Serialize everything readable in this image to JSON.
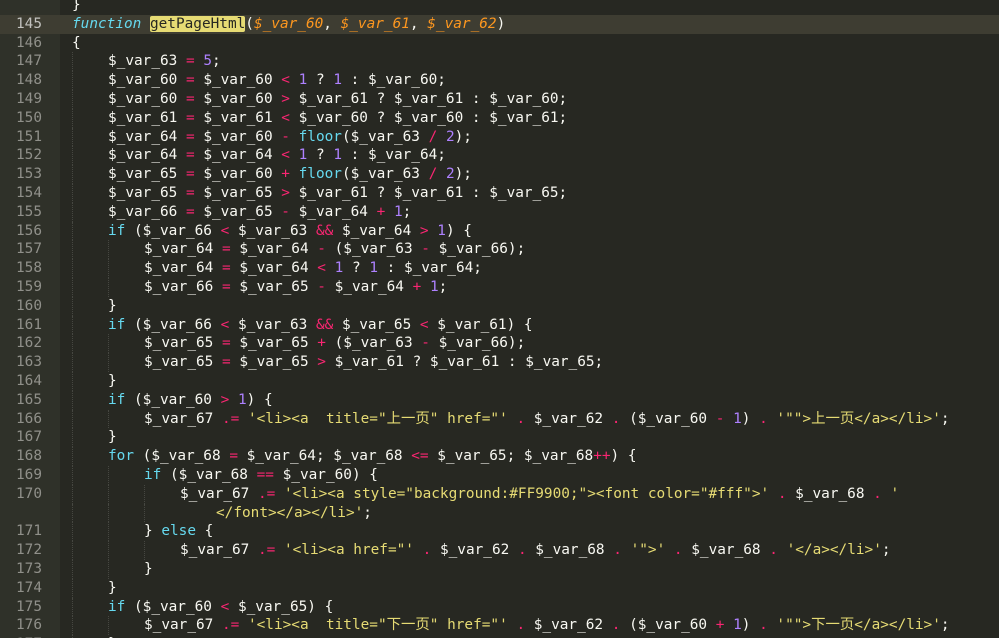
{
  "editor": {
    "theme_colors": {
      "background": "#272822",
      "keyword": "#66d9ef",
      "operator": "#f92672",
      "number": "#ae81ff",
      "string": "#e6db74",
      "param": "#fd971f",
      "text": "#f8f8f2"
    },
    "highlighted_line": "145",
    "lines": [
      {
        "n": "",
        "indent": 0,
        "tokens": [
          [
            "tx",
            "}"
          ]
        ]
      },
      {
        "n": "145",
        "indent": 0,
        "tokens": [
          [
            "kw",
            "function"
          ],
          [
            "tx",
            " "
          ],
          [
            "fn-hl",
            "getPageHtml"
          ],
          [
            "tx",
            "("
          ],
          [
            "pa",
            "$_var_60"
          ],
          [
            "tx",
            ", "
          ],
          [
            "pa",
            "$_var_61"
          ],
          [
            "tx",
            ", "
          ],
          [
            "pa",
            "$_var_62"
          ],
          [
            "tx",
            ")"
          ]
        ]
      },
      {
        "n": "146",
        "indent": 0,
        "tokens": [
          [
            "tx",
            "{"
          ]
        ]
      },
      {
        "n": "147",
        "indent": 1,
        "tokens": [
          [
            "tx",
            "$_var_63 "
          ],
          [
            "op",
            "="
          ],
          [
            "tx",
            " "
          ],
          [
            "num",
            "5"
          ],
          [
            "tx",
            ";"
          ]
        ]
      },
      {
        "n": "148",
        "indent": 1,
        "tokens": [
          [
            "tx",
            "$_var_60 "
          ],
          [
            "op",
            "="
          ],
          [
            "tx",
            " $_var_60 "
          ],
          [
            "op",
            "<"
          ],
          [
            "tx",
            " "
          ],
          [
            "num",
            "1"
          ],
          [
            "tx",
            " ? "
          ],
          [
            "num",
            "1"
          ],
          [
            "tx",
            " : $_var_60;"
          ]
        ]
      },
      {
        "n": "149",
        "indent": 1,
        "tokens": [
          [
            "tx",
            "$_var_60 "
          ],
          [
            "op",
            "="
          ],
          [
            "tx",
            " $_var_60 "
          ],
          [
            "op",
            ">"
          ],
          [
            "tx",
            " $_var_61 ? $_var_61 : $_var_60;"
          ]
        ]
      },
      {
        "n": "150",
        "indent": 1,
        "tokens": [
          [
            "tx",
            "$_var_61 "
          ],
          [
            "op",
            "="
          ],
          [
            "tx",
            " $_var_61 "
          ],
          [
            "op",
            "<"
          ],
          [
            "tx",
            " $_var_60 ? $_var_60 : $_var_61;"
          ]
        ]
      },
      {
        "n": "151",
        "indent": 1,
        "tokens": [
          [
            "tx",
            "$_var_64 "
          ],
          [
            "op",
            "="
          ],
          [
            "tx",
            " $_var_60 "
          ],
          [
            "op",
            "-"
          ],
          [
            "tx",
            " "
          ],
          [
            "bi",
            "floor"
          ],
          [
            "tx",
            "($_var_63 "
          ],
          [
            "op",
            "/"
          ],
          [
            "tx",
            " "
          ],
          [
            "num",
            "2"
          ],
          [
            "tx",
            ");"
          ]
        ]
      },
      {
        "n": "152",
        "indent": 1,
        "tokens": [
          [
            "tx",
            "$_var_64 "
          ],
          [
            "op",
            "="
          ],
          [
            "tx",
            " $_var_64 "
          ],
          [
            "op",
            "<"
          ],
          [
            "tx",
            " "
          ],
          [
            "num",
            "1"
          ],
          [
            "tx",
            " ? "
          ],
          [
            "num",
            "1"
          ],
          [
            "tx",
            " : $_var_64;"
          ]
        ]
      },
      {
        "n": "153",
        "indent": 1,
        "tokens": [
          [
            "tx",
            "$_var_65 "
          ],
          [
            "op",
            "="
          ],
          [
            "tx",
            " $_var_60 "
          ],
          [
            "op",
            "+"
          ],
          [
            "tx",
            " "
          ],
          [
            "bi",
            "floor"
          ],
          [
            "tx",
            "($_var_63 "
          ],
          [
            "op",
            "/"
          ],
          [
            "tx",
            " "
          ],
          [
            "num",
            "2"
          ],
          [
            "tx",
            ");"
          ]
        ]
      },
      {
        "n": "154",
        "indent": 1,
        "tokens": [
          [
            "tx",
            "$_var_65 "
          ],
          [
            "op",
            "="
          ],
          [
            "tx",
            " $_var_65 "
          ],
          [
            "op",
            ">"
          ],
          [
            "tx",
            " $_var_61 ? $_var_61 : $_var_65;"
          ]
        ]
      },
      {
        "n": "155",
        "indent": 1,
        "tokens": [
          [
            "tx",
            "$_var_66 "
          ],
          [
            "op",
            "="
          ],
          [
            "tx",
            " $_var_65 "
          ],
          [
            "op",
            "-"
          ],
          [
            "tx",
            " $_var_64 "
          ],
          [
            "op",
            "+"
          ],
          [
            "tx",
            " "
          ],
          [
            "num",
            "1"
          ],
          [
            "tx",
            ";"
          ]
        ]
      },
      {
        "n": "156",
        "indent": 1,
        "tokens": [
          [
            "kf",
            "if"
          ],
          [
            "tx",
            " ($_var_66 "
          ],
          [
            "op",
            "<"
          ],
          [
            "tx",
            " $_var_63 "
          ],
          [
            "op",
            "&&"
          ],
          [
            "tx",
            " $_var_64 "
          ],
          [
            "op",
            ">"
          ],
          [
            "tx",
            " "
          ],
          [
            "num",
            "1"
          ],
          [
            "tx",
            ") {"
          ]
        ]
      },
      {
        "n": "157",
        "indent": 2,
        "tokens": [
          [
            "tx",
            "$_var_64 "
          ],
          [
            "op",
            "="
          ],
          [
            "tx",
            " $_var_64 "
          ],
          [
            "op",
            "-"
          ],
          [
            "tx",
            " ($_var_63 "
          ],
          [
            "op",
            "-"
          ],
          [
            "tx",
            " $_var_66);"
          ]
        ]
      },
      {
        "n": "158",
        "indent": 2,
        "tokens": [
          [
            "tx",
            "$_var_64 "
          ],
          [
            "op",
            "="
          ],
          [
            "tx",
            " $_var_64 "
          ],
          [
            "op",
            "<"
          ],
          [
            "tx",
            " "
          ],
          [
            "num",
            "1"
          ],
          [
            "tx",
            " ? "
          ],
          [
            "num",
            "1"
          ],
          [
            "tx",
            " : $_var_64;"
          ]
        ]
      },
      {
        "n": "159",
        "indent": 2,
        "tokens": [
          [
            "tx",
            "$_var_66 "
          ],
          [
            "op",
            "="
          ],
          [
            "tx",
            " $_var_65 "
          ],
          [
            "op",
            "-"
          ],
          [
            "tx",
            " $_var_64 "
          ],
          [
            "op",
            "+"
          ],
          [
            "tx",
            " "
          ],
          [
            "num",
            "1"
          ],
          [
            "tx",
            ";"
          ]
        ]
      },
      {
        "n": "160",
        "indent": 1,
        "tokens": [
          [
            "tx",
            "}"
          ]
        ]
      },
      {
        "n": "161",
        "indent": 1,
        "tokens": [
          [
            "kf",
            "if"
          ],
          [
            "tx",
            " ($_var_66 "
          ],
          [
            "op",
            "<"
          ],
          [
            "tx",
            " $_var_63 "
          ],
          [
            "op",
            "&&"
          ],
          [
            "tx",
            " $_var_65 "
          ],
          [
            "op",
            "<"
          ],
          [
            "tx",
            " $_var_61) {"
          ]
        ]
      },
      {
        "n": "162",
        "indent": 2,
        "tokens": [
          [
            "tx",
            "$_var_65 "
          ],
          [
            "op",
            "="
          ],
          [
            "tx",
            " $_var_65 "
          ],
          [
            "op",
            "+"
          ],
          [
            "tx",
            " ($_var_63 "
          ],
          [
            "op",
            "-"
          ],
          [
            "tx",
            " $_var_66);"
          ]
        ]
      },
      {
        "n": "163",
        "indent": 2,
        "tokens": [
          [
            "tx",
            "$_var_65 "
          ],
          [
            "op",
            "="
          ],
          [
            "tx",
            " $_var_65 "
          ],
          [
            "op",
            ">"
          ],
          [
            "tx",
            " $_var_61 ? $_var_61 : $_var_65;"
          ]
        ]
      },
      {
        "n": "164",
        "indent": 1,
        "tokens": [
          [
            "tx",
            "}"
          ]
        ]
      },
      {
        "n": "165",
        "indent": 1,
        "tokens": [
          [
            "kf",
            "if"
          ],
          [
            "tx",
            " ($_var_60 "
          ],
          [
            "op",
            ">"
          ],
          [
            "tx",
            " "
          ],
          [
            "num",
            "1"
          ],
          [
            "tx",
            ") {"
          ]
        ]
      },
      {
        "n": "166",
        "indent": 2,
        "tokens": [
          [
            "tx",
            "$_var_67 "
          ],
          [
            "op",
            ".="
          ],
          [
            "tx",
            " "
          ],
          [
            "str",
            "'<li><a  title=\"上一页\" href=\"'"
          ],
          [
            "tx",
            " "
          ],
          [
            "op",
            "."
          ],
          [
            "tx",
            " $_var_62 "
          ],
          [
            "op",
            "."
          ],
          [
            "tx",
            " ($_var_60 "
          ],
          [
            "op",
            "-"
          ],
          [
            "tx",
            " "
          ],
          [
            "num",
            "1"
          ],
          [
            "tx",
            ") "
          ],
          [
            "op",
            "."
          ],
          [
            "tx",
            " "
          ],
          [
            "str",
            "'\"\">上一页</a></li>'"
          ],
          [
            "tx",
            ";"
          ]
        ]
      },
      {
        "n": "167",
        "indent": 1,
        "tokens": [
          [
            "tx",
            "}"
          ]
        ]
      },
      {
        "n": "168",
        "indent": 1,
        "tokens": [
          [
            "kf",
            "for"
          ],
          [
            "tx",
            " ($_var_68 "
          ],
          [
            "op",
            "="
          ],
          [
            "tx",
            " $_var_64; $_var_68 "
          ],
          [
            "op",
            "<="
          ],
          [
            "tx",
            " $_var_65; $_var_68"
          ],
          [
            "op",
            "++"
          ],
          [
            "tx",
            ") {"
          ]
        ]
      },
      {
        "n": "169",
        "indent": 2,
        "tokens": [
          [
            "kf",
            "if"
          ],
          [
            "tx",
            " ($_var_68 "
          ],
          [
            "op",
            "=="
          ],
          [
            "tx",
            " $_var_60) {"
          ]
        ]
      },
      {
        "n": "170",
        "indent": 3,
        "tokens": [
          [
            "tx",
            "$_var_67 "
          ],
          [
            "op",
            ".="
          ],
          [
            "tx",
            " "
          ],
          [
            "str",
            "'<li><a style=\"background:#FF9900;\"><font color=\"#fff\">'"
          ],
          [
            "tx",
            " "
          ],
          [
            "op",
            "."
          ],
          [
            "tx",
            " $_var_68 "
          ],
          [
            "op",
            "."
          ],
          [
            "tx",
            " "
          ],
          [
            "str",
            "'"
          ]
        ]
      },
      {
        "n": "",
        "indent": 4,
        "tokens": [
          [
            "str",
            "</font></a></li>'"
          ],
          [
            "tx",
            ";"
          ]
        ]
      },
      {
        "n": "171",
        "indent": 2,
        "tokens": [
          [
            "tx",
            "} "
          ],
          [
            "kf",
            "else"
          ],
          [
            "tx",
            " {"
          ]
        ]
      },
      {
        "n": "172",
        "indent": 3,
        "tokens": [
          [
            "tx",
            "$_var_67 "
          ],
          [
            "op",
            ".="
          ],
          [
            "tx",
            " "
          ],
          [
            "str",
            "'<li><a href=\"'"
          ],
          [
            "tx",
            " "
          ],
          [
            "op",
            "."
          ],
          [
            "tx",
            " $_var_62 "
          ],
          [
            "op",
            "."
          ],
          [
            "tx",
            " $_var_68 "
          ],
          [
            "op",
            "."
          ],
          [
            "tx",
            " "
          ],
          [
            "str",
            "'\">'"
          ],
          [
            "tx",
            " "
          ],
          [
            "op",
            "."
          ],
          [
            "tx",
            " $_var_68 "
          ],
          [
            "op",
            "."
          ],
          [
            "tx",
            " "
          ],
          [
            "str",
            "'</a></li>'"
          ],
          [
            "tx",
            ";"
          ]
        ]
      },
      {
        "n": "173",
        "indent": 2,
        "tokens": [
          [
            "tx",
            "}"
          ]
        ]
      },
      {
        "n": "174",
        "indent": 1,
        "tokens": [
          [
            "tx",
            "}"
          ]
        ]
      },
      {
        "n": "175",
        "indent": 1,
        "tokens": [
          [
            "kf",
            "if"
          ],
          [
            "tx",
            " ($_var_60 "
          ],
          [
            "op",
            "<"
          ],
          [
            "tx",
            " $_var_65) {"
          ]
        ]
      },
      {
        "n": "176",
        "indent": 2,
        "tokens": [
          [
            "tx",
            "$_var_67 "
          ],
          [
            "op",
            ".="
          ],
          [
            "tx",
            " "
          ],
          [
            "str",
            "'<li><a  title=\"下一页\" href=\"'"
          ],
          [
            "tx",
            " "
          ],
          [
            "op",
            "."
          ],
          [
            "tx",
            " $_var_62 "
          ],
          [
            "op",
            "."
          ],
          [
            "tx",
            " ($_var_60 "
          ],
          [
            "op",
            "+"
          ],
          [
            "tx",
            " "
          ],
          [
            "num",
            "1"
          ],
          [
            "tx",
            ") "
          ],
          [
            "op",
            "."
          ],
          [
            "tx",
            " "
          ],
          [
            "str",
            "'\"\">下一页</a></li>'"
          ],
          [
            "tx",
            ";"
          ]
        ]
      },
      {
        "n": "177",
        "indent": 1,
        "tokens": [
          [
            "tx",
            "}"
          ]
        ]
      }
    ]
  }
}
